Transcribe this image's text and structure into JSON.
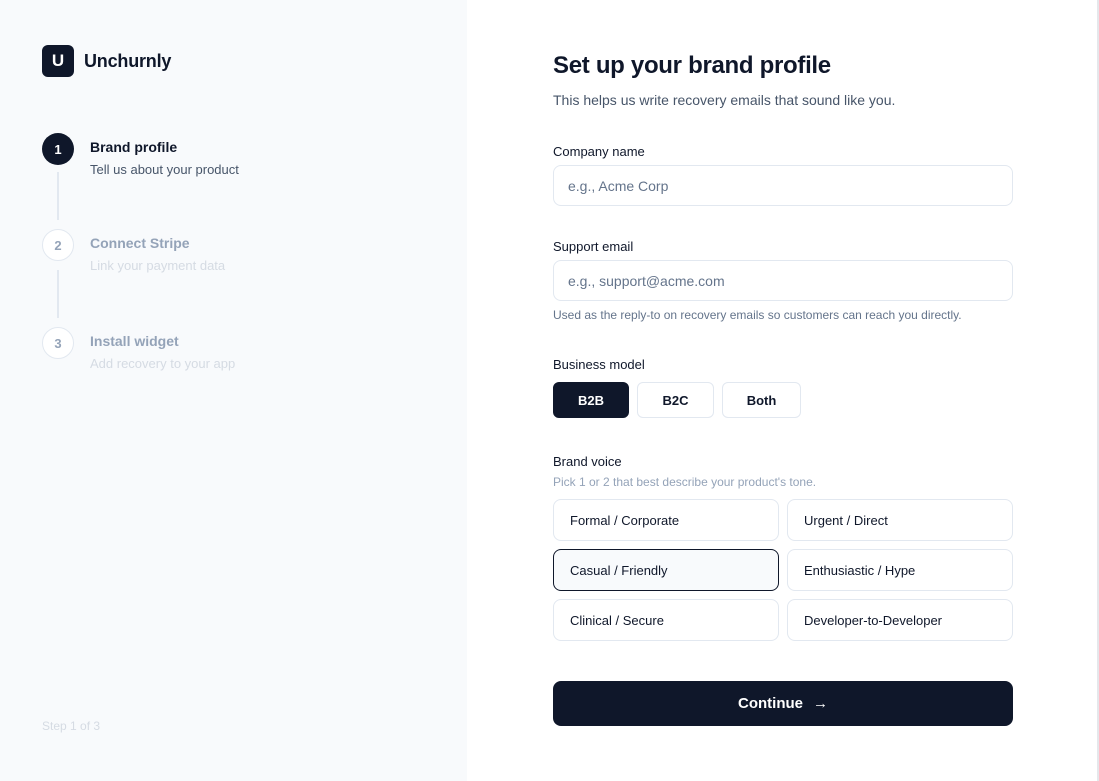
{
  "brand": {
    "logo_letter": "U",
    "name": "Unchurnly"
  },
  "steps": [
    {
      "number": "1",
      "title": "Brand profile",
      "subtitle": "Tell us about your product",
      "state": "active"
    },
    {
      "number": "2",
      "title": "Connect Stripe",
      "subtitle": "Link your payment data",
      "state": "inactive"
    },
    {
      "number": "3",
      "title": "Install widget",
      "subtitle": "Add recovery to your app",
      "state": "inactive"
    }
  ],
  "step_count": "Step 1 of 3",
  "form": {
    "title": "Set up your brand profile",
    "subtitle": "This helps us write recovery emails that sound like you.",
    "company": {
      "label": "Company name",
      "placeholder": "e.g., Acme Corp",
      "value": ""
    },
    "support": {
      "label": "Support email",
      "placeholder": "e.g., support@acme.com",
      "value": "",
      "hint": "Used as the reply-to on recovery emails so customers can reach you directly."
    },
    "business_model": {
      "label": "Business model",
      "options": [
        "B2B",
        "B2C",
        "Both"
      ],
      "selected": "B2B"
    },
    "brand_voice": {
      "label": "Brand voice",
      "hint": "Pick 1 or 2 that best describe your product's tone.",
      "options": [
        "Formal / Corporate",
        "Urgent / Direct",
        "Casual / Friendly",
        "Enthusiastic / Hype",
        "Clinical / Secure",
        "Developer-to-Developer"
      ],
      "selected": [
        "Casual / Friendly"
      ]
    },
    "continue_label": "Continue",
    "continue_icon": "arrow-right-icon"
  },
  "colors": {
    "primary": "#0f172a",
    "sidebar_bg": "#f8fafc",
    "border": "#e2e8f0"
  }
}
